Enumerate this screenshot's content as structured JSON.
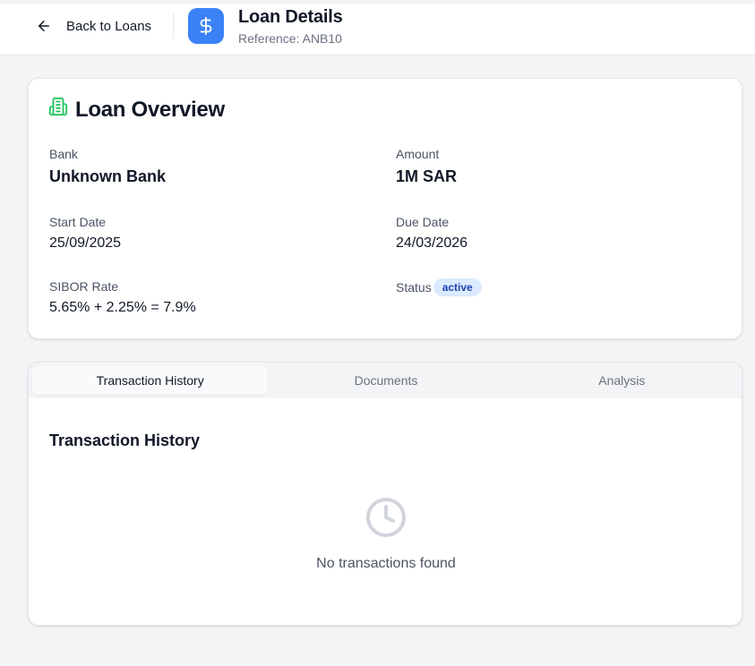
{
  "header": {
    "back_label": "Back to Loans",
    "title": "Loan Details",
    "reference": "Reference: ANB10",
    "icon": "dollar-icon",
    "accent": "#3b82f6"
  },
  "overview": {
    "title": "Loan Overview",
    "icon": "building-icon",
    "icon_color": "#22c55e",
    "fields": {
      "bank_label": "Bank",
      "bank_value": "Unknown Bank",
      "amount_label": "Amount",
      "amount_value": "1M SAR",
      "start_label": "Start Date",
      "start_value": "25/09/2025",
      "due_label": "Due Date",
      "due_value": "24/03/2026",
      "sibor_label": "SIBOR Rate",
      "sibor_value": "5.65% + 2.25% = 7.9%",
      "status_label": "Status",
      "status_value": "active"
    }
  },
  "tabs": {
    "items": [
      {
        "label": "Transaction History",
        "active": true
      },
      {
        "label": "Documents",
        "active": false
      },
      {
        "label": "Analysis",
        "active": false
      }
    ]
  },
  "transactions": {
    "title": "Transaction History",
    "empty_icon": "clock-icon",
    "empty_text": "No transactions found"
  }
}
